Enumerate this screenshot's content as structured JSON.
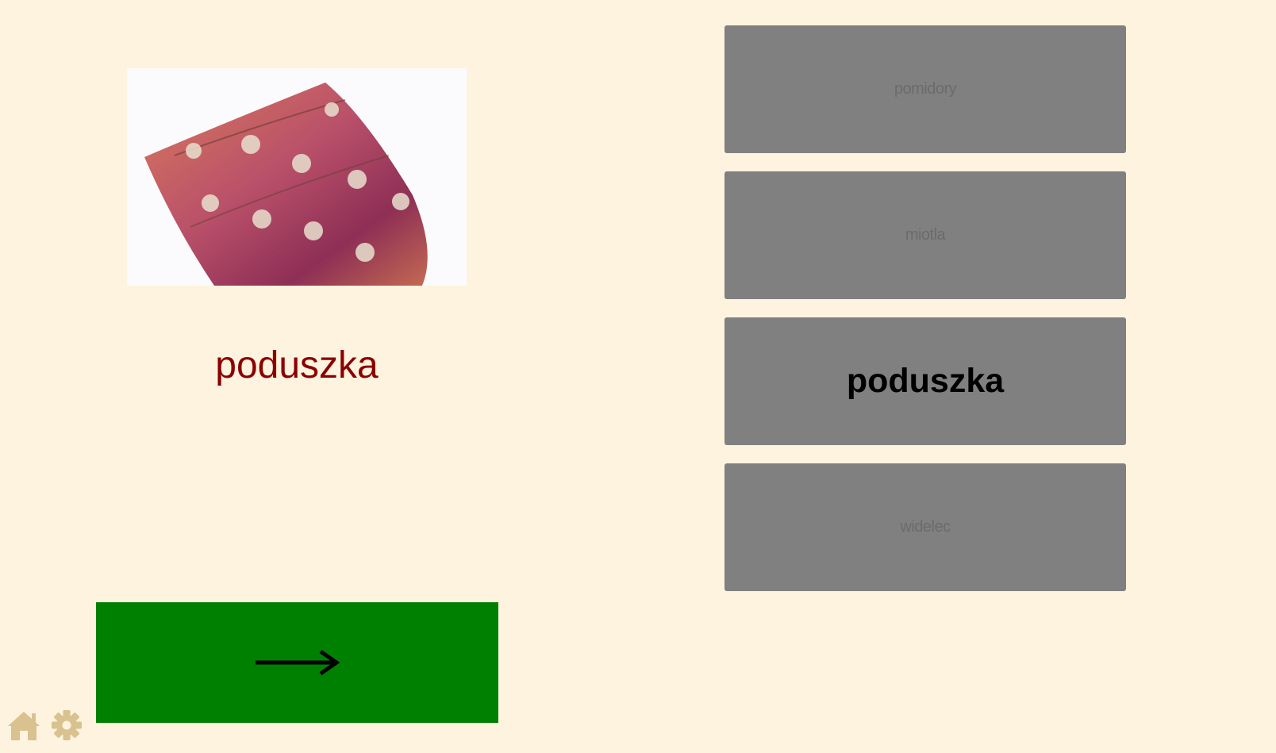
{
  "lesson": {
    "image_icon": "pillow-photo",
    "word": "poduszka"
  },
  "next_button": {
    "icon": "long-right-arrow-icon",
    "color": "#008000"
  },
  "options": [
    {
      "label": "pomidory",
      "selected": false
    },
    {
      "label": "miotla",
      "selected": false
    },
    {
      "label": "poduszka",
      "selected": true
    },
    {
      "label": "widelec",
      "selected": false
    }
  ],
  "footer": {
    "icons": [
      "home-icon",
      "gear-icon"
    ],
    "icon_color": "#d9c28f"
  },
  "colors": {
    "background": "#fdf3de",
    "word": "#8b0000",
    "option_background": "#808080"
  }
}
